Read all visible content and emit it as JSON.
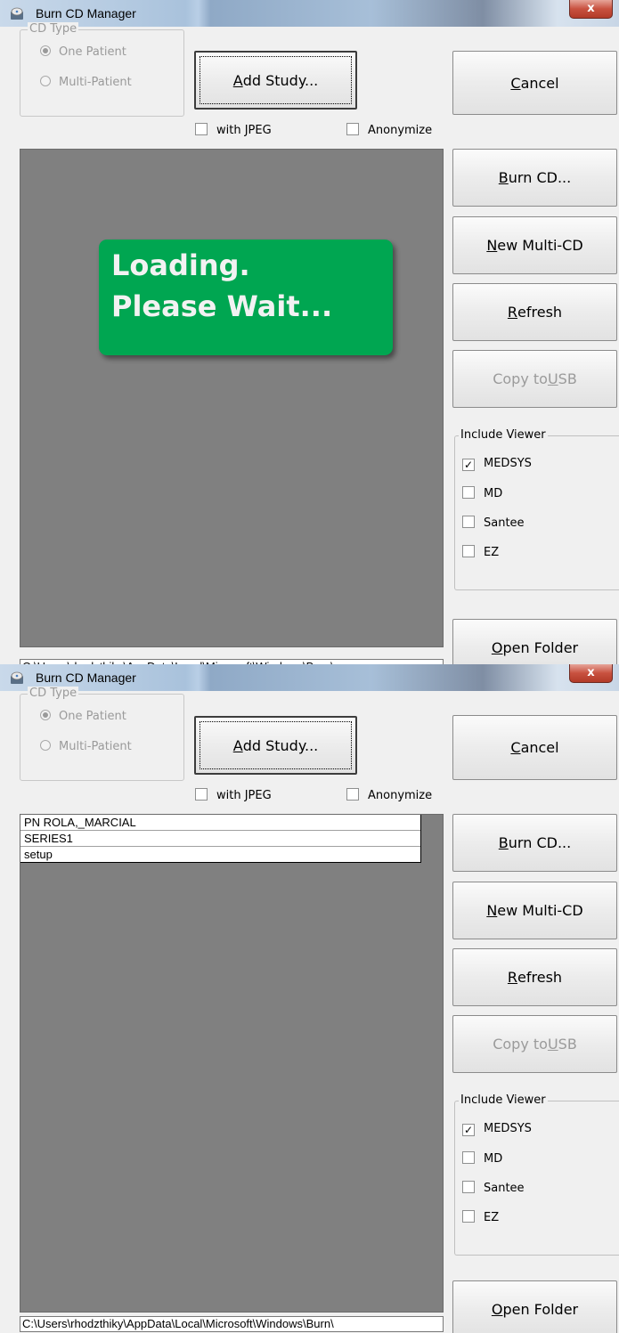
{
  "app": {
    "title": "Burn CD Manager",
    "close_glyph": "x"
  },
  "cd_type": {
    "legend": "CD Type",
    "options": [
      {
        "label": "One Patient",
        "selected": true
      },
      {
        "label": "Multi-Patient",
        "selected": false
      }
    ]
  },
  "buttons": {
    "add_study": {
      "before": "",
      "accel": "A",
      "after": "dd Study..."
    },
    "cancel": {
      "before": "",
      "accel": "C",
      "after": "ancel"
    },
    "burn_cd": {
      "before": "",
      "accel": "B",
      "after": "urn CD..."
    },
    "new_multi_cd": {
      "before": "",
      "accel": "N",
      "after": "ew Multi-CD"
    },
    "refresh": {
      "before": "",
      "accel": "R",
      "after": "efresh"
    },
    "copy_to_usb": {
      "before": "Copy to ",
      "accel": "U",
      "after": "SB"
    },
    "open_folder": {
      "before": "",
      "accel": "O",
      "after": "pen Folder"
    }
  },
  "options": {
    "with_jpeg": "with JPEG",
    "anonymize": "Anonymize"
  },
  "loading": {
    "line1": "Loading.",
    "line2": "Please Wait..."
  },
  "study_list": [
    "PN ROLA,_MARCIAL",
    "SERIES1",
    "setup"
  ],
  "include_viewer": {
    "legend": "Include Viewer",
    "options": [
      {
        "label": "MEDSYS",
        "checked": true
      },
      {
        "label": "MD",
        "checked": false
      },
      {
        "label": "Santee",
        "checked": false
      },
      {
        "label": "EZ",
        "checked": false
      }
    ]
  },
  "path": {
    "text": "C:\\Users\\rhodzthiky\\AppData\\Local\\Microsoft\\Windows\\Burn\\"
  },
  "colors": {
    "loading_bg": "#00a651",
    "panel_bg": "#808080",
    "close_red": "#c8513f"
  }
}
